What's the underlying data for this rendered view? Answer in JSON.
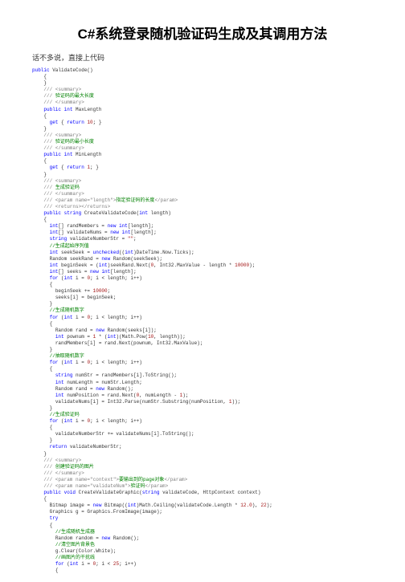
{
  "title": "C#系统登录随机验证码生成及其调用方法",
  "intro": "话不多说，直接上代码",
  "code": {
    "l1_kw": "public",
    "l1_rest": " ValidateCode()",
    "l2": "{",
    "l3": "}",
    "l4": "/// <summary>",
    "l5_pre": "/// ",
    "l5_txt": "验证码的最大长度",
    "l6": "/// </summary>",
    "l7_kw1": "public",
    "l7_kw2": "int",
    "l7_rest": " MaxLength",
    "l8": "{",
    "l9_kw1": "get",
    "l9_mid": " { ",
    "l9_kw2": "return",
    "l9_num": " 10",
    "l9_end": "; }",
    "l10": "}",
    "l11": "/// <summary>",
    "l12_pre": "/// ",
    "l12_txt": "验证码的最小长度",
    "l13": "/// </summary>",
    "l14_kw1": "public",
    "l14_kw2": "int",
    "l14_rest": " MinLength",
    "l15": "{",
    "l16_kw1": "get",
    "l16_mid": " { ",
    "l16_kw2": "return",
    "l16_num": " 1",
    "l16_end": "; }",
    "l17": "}",
    "l18": "/// <summary>",
    "l19_pre": "/// ",
    "l19_txt": "生成验证码",
    "l20": "/// </summary>",
    "l21_pre": "/// <param name=\"length\">",
    "l21_txt": "指定验证码的长度",
    "l21_end": "</param>",
    "l22": "/// <returns></returns>",
    "l23_kw1": "public",
    "l23_kw2": "string",
    "l23_mid": " CreateValidateCode(",
    "l23_kw3": "int",
    "l23_end": " length)",
    "l24": "{",
    "l25_kw": "int",
    "l25_mid": "[] randMembers = ",
    "l25_kw2": "new",
    "l25_kw3": "int",
    "l25_end": "[length];",
    "l26_kw": "int",
    "l26_mid": "[] validateNums = ",
    "l26_kw2": "new",
    "l26_kw3": "int",
    "l26_end": "[length];",
    "l27_kw": "string",
    "l27_mid": " validateNumberStr = ",
    "l27_str": "\"\"",
    "l27_end": ";",
    "l28": "//生成起始序列值",
    "l29_kw": "int",
    "l29_mid": " seekSeek = ",
    "l29_kw2": "unchecked",
    "l29_mid2": "((",
    "l29_kw3": "int",
    "l29_end": ")DateTime.Now.Ticks);",
    "l30_pre": "Random seekRand = ",
    "l30_kw": "new",
    "l30_end": " Random(seekSeek);",
    "l31_kw": "int",
    "l31_mid": " beginSeek = (",
    "l31_kw2": "int",
    "l31_mid2": ")seekRand.Next(",
    "l31_num1": "0",
    "l31_mid3": ", Int32.MaxValue - length * ",
    "l31_num2": "10000",
    "l31_end": ");",
    "l32_kw": "int",
    "l32_mid": "[] seeks = ",
    "l32_kw2": "new",
    "l32_kw3": "int",
    "l32_end": "[length];",
    "l33_kw": "for",
    "l33_mid": " (",
    "l33_kw2": "int",
    "l33_mid2": " i = ",
    "l33_num": "0",
    "l33_end": "; i < length; i++)",
    "l34": "{",
    "l35_pre": "beginSeek += ",
    "l35_num": "10000",
    "l35_end": ";",
    "l36": "seeks[i] = beginSeek;",
    "l37": "}",
    "l38": "//生成随机数字",
    "l39_kw": "for",
    "l39_mid": " (",
    "l39_kw2": "int",
    "l39_mid2": " i = ",
    "l39_num": "0",
    "l39_end": "; i < length; i++)",
    "l40": "{",
    "l41_pre": "Random rand = ",
    "l41_kw": "new",
    "l41_end": " Random(seeks[i]);",
    "l42_kw": "int",
    "l42_mid": " pownum = ",
    "l42_num1": "1",
    "l42_mid2": " * (",
    "l42_kw2": "int",
    "l42_mid3": ")(Math.Pow(",
    "l42_num2": "10",
    "l42_end": ", length));",
    "l43": "randMembers[i] = rand.Next(pownum, Int32.MaxValue);",
    "l44": "}",
    "l45": "//抽取随机数字",
    "l46_kw": "for",
    "l46_mid": " (",
    "l46_kw2": "int",
    "l46_mid2": " i = ",
    "l46_num": "0",
    "l46_end": "; i < length; i++)",
    "l47": "{",
    "l48_kw": "string",
    "l48_end": " numStr = randMembers[i].ToString();",
    "l49_kw": "int",
    "l49_end": " numLength = numStr.Length;",
    "l50_pre": "Random rand = ",
    "l50_kw": "new",
    "l50_end": " Random();",
    "l51_kw": "int",
    "l51_mid": " numPosition = rand.Next(",
    "l51_num1": "0",
    "l51_mid2": ", numLength - ",
    "l51_num2": "1",
    "l51_end": ");",
    "l52_pre": "validateNums[i] = Int32.Parse(numStr.Substring(numPosition, ",
    "l52_num": "1",
    "l52_end": "));",
    "l53": "}",
    "l54": "//生成验证码",
    "l55_kw": "for",
    "l55_mid": " (",
    "l55_kw2": "int",
    "l55_mid2": " i = ",
    "l55_num": "0",
    "l55_end": "; i < length; i++)",
    "l56": "{",
    "l57": "validateNumberStr += validateNums[i].ToString();",
    "l58": "}",
    "l59_kw": "return",
    "l59_end": " validateNumberStr;",
    "l60": "}",
    "l61": "/// <summary>",
    "l62_pre": "/// ",
    "l62_txt": "创建验证码的图片",
    "l63": "/// </summary>",
    "l64_pre": "/// <param name=\"context\">",
    "l64_txt": "要输出到的page对象",
    "l64_end": "</param>",
    "l65_pre": "/// <param name=\"validateNum\">",
    "l65_txt": "验证码",
    "l65_end": "</param>",
    "l66_kw1": "public",
    "l66_kw2": "void",
    "l66_mid": " CreateValidateGraphic(",
    "l66_kw3": "string",
    "l66_end": " validateCode, HttpContext context)",
    "l67": "{",
    "l68_pre": "Bitmap image = ",
    "l68_kw": "new",
    "l68_mid": " Bitmap((",
    "l68_kw2": "int",
    "l68_mid2": ")Math.Ceiling(validateCode.Length * ",
    "l68_num1": "12.0",
    "l68_mid3": "), ",
    "l68_num2": "22",
    "l68_end": ");",
    "l69": "Graphics g = Graphics.FromImage(image);",
    "l70_kw": "try",
    "l71": "{",
    "l72": "//生成随机生成器",
    "l73_pre": "Random random = ",
    "l73_kw": "new",
    "l73_end": " Random();",
    "l74": "//清空图片背景色",
    "l75": "g.Clear(Color.White);",
    "l76": "//画图片的干扰线",
    "l77_kw": "for",
    "l77_mid": " (",
    "l77_kw2": "int",
    "l77_mid2": " i = ",
    "l77_num1": "0",
    "l77_mid3": "; i < ",
    "l77_num2": "25",
    "l77_end": "; i++)",
    "l78": "{"
  }
}
